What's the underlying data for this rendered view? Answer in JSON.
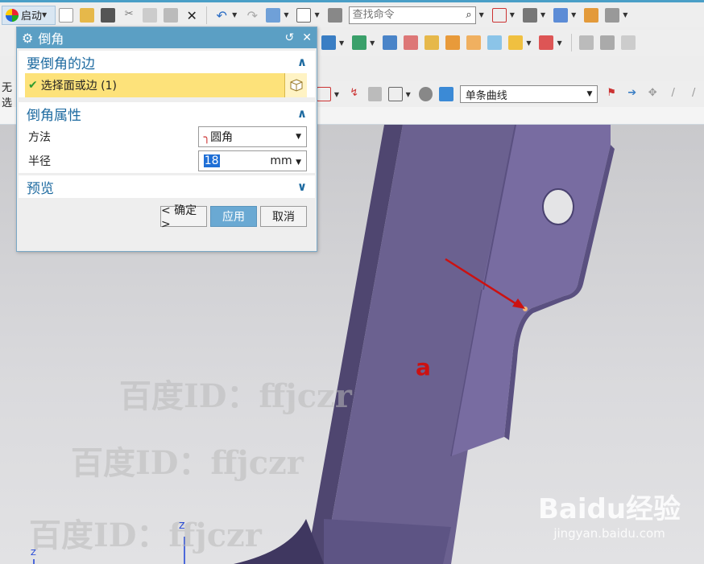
{
  "toolbar": {
    "start_label": "启动",
    "search_placeholder": "查找命令",
    "curve_rule": "单条曲线",
    "filter_text": "无选"
  },
  "dialog": {
    "title": "倒角",
    "group_edges": {
      "header": "要倒角的边",
      "select_label": "选择面或边 (1)"
    },
    "group_props": {
      "header": "倒角属性",
      "method_label": "方法",
      "method_value": "圆角",
      "radius_label": "半径",
      "radius_value": "18",
      "radius_unit": "mm"
    },
    "group_preview": {
      "header": "预览"
    },
    "buttons": {
      "ok": "< 确定 >",
      "apply": "应用",
      "cancel": "取消"
    }
  },
  "viewport": {
    "annotation": "a",
    "watermarks": [
      "百度ID：ffjczr",
      "百度ID：ffjczr",
      "百度ID：ffjczr"
    ],
    "logo_text": "Baidu经验",
    "logo_url": "jingyan.baidu.com",
    "axis_label": "Z"
  },
  "colors": {
    "part": "#6f6592",
    "title_bar": "#5b9fc4",
    "highlight": "#fde27a",
    "arrow": "#cc1111"
  }
}
